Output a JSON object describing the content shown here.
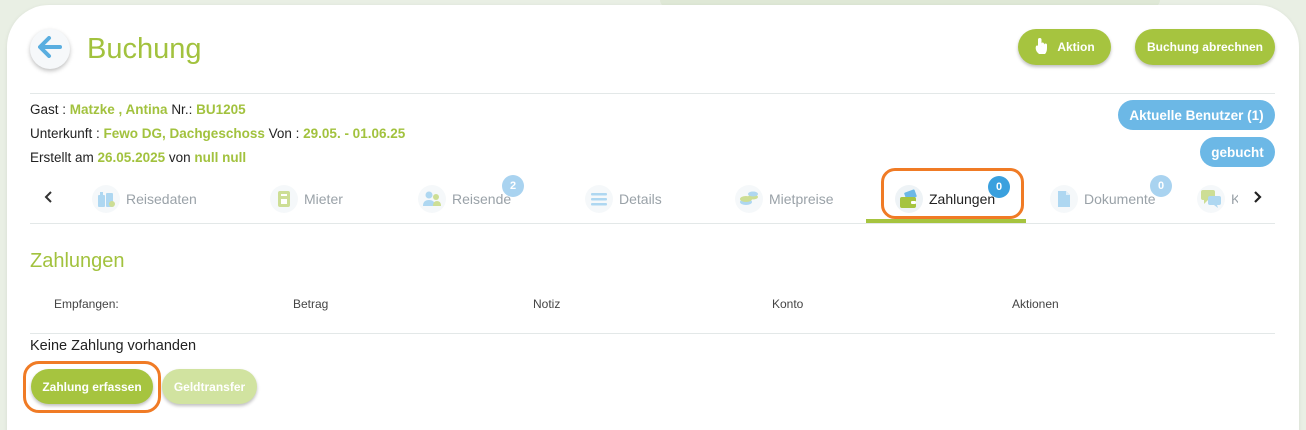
{
  "header": {
    "title": "Buchung",
    "action_label": "Aktion",
    "invoice_label": "Buchung abrechnen"
  },
  "info": {
    "guest_label": "Gast :",
    "guest_name": "Matzke , Antina",
    "nr_label": "Nr.:",
    "nr_value": "BU1205",
    "accommodation_label": "Unterkunft :",
    "accommodation_value": "Fewo DG, Dachgeschoss",
    "von_label": "Von :",
    "period_value": "29.05. - 01.06.25",
    "created_label": "Erstellt am",
    "created_date": "26.05.2025",
    "created_by_label": "von",
    "created_by": "null null"
  },
  "badges": {
    "current_users": "Aktuelle Benutzer (1)",
    "status": "gebucht"
  },
  "tabs": [
    {
      "label": "Reisedaten",
      "icon": "suitcase-icon",
      "badge": null
    },
    {
      "label": "Mieter",
      "icon": "id-card-icon",
      "badge": null
    },
    {
      "label": "Reisende",
      "icon": "people-icon",
      "badge": "2"
    },
    {
      "label": "Details",
      "icon": "list-icon",
      "badge": null
    },
    {
      "label": "Mietpreise",
      "icon": "coins-icon",
      "badge": null
    },
    {
      "label": "Zahlungen",
      "icon": "wallet-icon",
      "badge": "0",
      "active": true
    },
    {
      "label": "Dokumente",
      "icon": "document-icon",
      "badge": "0"
    },
    {
      "label": "K",
      "icon": "chat-icon",
      "badge": null
    }
  ],
  "payments": {
    "title": "Zahlungen",
    "columns": [
      "Empfangen:",
      "Betrag",
      "Notiz",
      "Konto",
      "Aktionen"
    ],
    "empty_text": "Keine Zahlung vorhanden",
    "add_label": "Zahlung erfassen",
    "transfer_label": "Geldtransfer"
  },
  "colors": {
    "accent_green": "#a2c23e",
    "accent_blue": "#6cb8e6",
    "highlight_orange": "#f07b25"
  }
}
